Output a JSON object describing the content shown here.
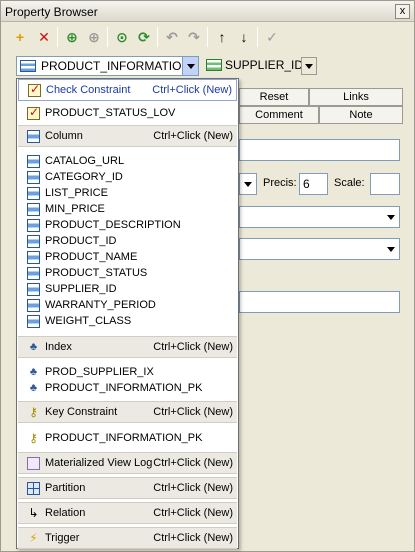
{
  "window": {
    "title": "Property Browser",
    "close_label": "x"
  },
  "toolbar": {
    "icons": [
      "add-icon",
      "delete-icon",
      "green-add-icon",
      "gray-add-icon",
      "green-circle-icon",
      "green-refresh-icon",
      "undo-icon",
      "redo-icon",
      "arrow-up-icon",
      "arrow-down-icon",
      "check-icon"
    ],
    "glyphs": [
      "+",
      "✕",
      "⊕",
      "⊕",
      "⊙",
      "⟳",
      "↶",
      "↷",
      "↑",
      "↓",
      "✓"
    ]
  },
  "selector": {
    "object_name": "PRODUCT_INFORMATION",
    "secondary_name": "SUPPLIER_ID"
  },
  "panel": {
    "tabs_row1": [
      "Reset",
      "Links"
    ],
    "tabs_row2": [
      "Comment",
      "Note"
    ],
    "precis_label": "Precis:",
    "precis_value": "6",
    "scale_label": "Scale:",
    "scale_value": ""
  },
  "dropdown": {
    "check_constraint": {
      "label": "Check Constraint",
      "shortcut": "Ctrl+Click (New)"
    },
    "check_items": [
      "PRODUCT_STATUS_LOV"
    ],
    "column": {
      "label": "Column",
      "shortcut": "Ctrl+Click (New)"
    },
    "column_items": [
      "CATALOG_URL",
      "CATEGORY_ID",
      "LIST_PRICE",
      "MIN_PRICE",
      "PRODUCT_DESCRIPTION",
      "PRODUCT_ID",
      "PRODUCT_NAME",
      "PRODUCT_STATUS",
      "SUPPLIER_ID",
      "WARRANTY_PERIOD",
      "WEIGHT_CLASS"
    ],
    "index": {
      "label": "Index",
      "shortcut": "Ctrl+Click (New)"
    },
    "index_items": [
      "PROD_SUPPLIER_IX",
      "PRODUCT_INFORMATION_PK"
    ],
    "key_constraint": {
      "label": "Key Constraint",
      "shortcut": "Ctrl+Click (New)"
    },
    "key_items": [
      "PRODUCT_INFORMATION_PK"
    ],
    "materialized_view_log": {
      "label": "Materialized View Log",
      "shortcut": "Ctrl+Click (New)"
    },
    "partition": {
      "label": "Partition",
      "shortcut": "Ctrl+Click (New)"
    },
    "relation": {
      "label": "Relation",
      "shortcut": "Ctrl+Click (New)"
    },
    "trigger": {
      "label": "Trigger",
      "shortcut": "Ctrl+Click (New)"
    }
  }
}
